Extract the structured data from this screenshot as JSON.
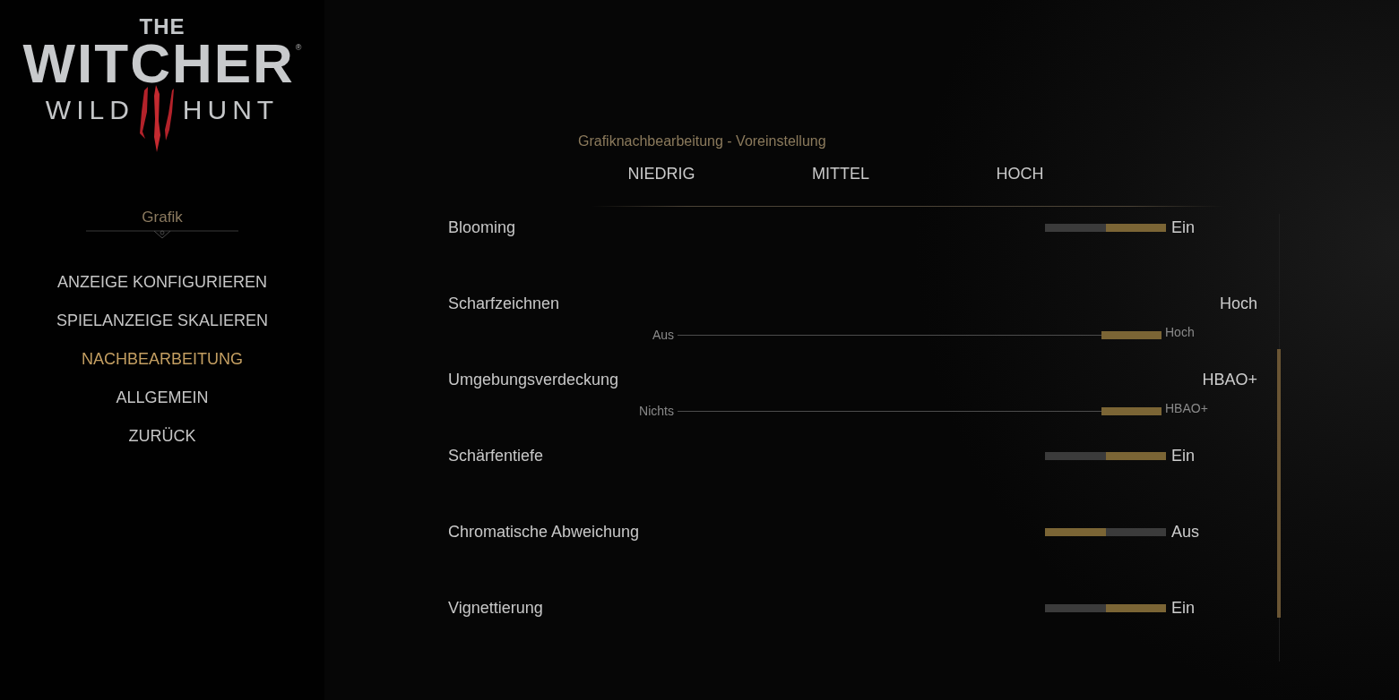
{
  "logo": {
    "top": "THE",
    "main": "WITCHER",
    "mark": "®",
    "left": "WILD",
    "right": "HUNT"
  },
  "sidebar": {
    "heading": "Grafik",
    "items": [
      {
        "label": "ANZEIGE KONFIGURIEREN",
        "selected": false
      },
      {
        "label": "SPIELANZEIGE SKALIEREN",
        "selected": false
      },
      {
        "label": "NACHBEARBEITUNG",
        "selected": true
      },
      {
        "label": "ALLGEMEIN",
        "selected": false
      },
      {
        "label": "ZURÜCK",
        "selected": false
      }
    ]
  },
  "preset": {
    "title": "Grafiknachbearbeitung - Voreinstellung",
    "options": [
      "NIEDRIG",
      "MITTEL",
      "HOCH"
    ]
  },
  "settings": [
    {
      "kind": "toggle",
      "label": "Blooming",
      "on": true,
      "value": "Ein"
    },
    {
      "kind": "slider",
      "label": "Scharfzeichnen",
      "value": "Hoch",
      "min_label": "Aus",
      "max_label": "Hoch",
      "level": 1
    },
    {
      "kind": "slider",
      "label": "Umgebungsverdeckung",
      "value": "HBAO+",
      "min_label": "Nichts",
      "max_label": "HBAO+",
      "level": 1
    },
    {
      "kind": "toggle",
      "label": "Schärfentiefe",
      "on": true,
      "value": "Ein"
    },
    {
      "kind": "toggle",
      "label": "Chromatische Abweichung",
      "on": false,
      "value": "Aus"
    },
    {
      "kind": "toggle",
      "label": "Vignettierung",
      "on": true,
      "value": "Ein"
    }
  ]
}
